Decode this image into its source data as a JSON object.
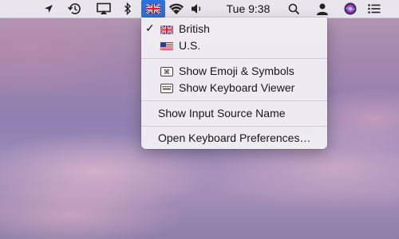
{
  "menubar": {
    "clock": "Tue 9:38",
    "icons": [
      "location-arrow-icon",
      "time-machine-icon",
      "airplay-icon",
      "bluetooth-icon",
      "input-source-flag-icon",
      "wifi-icon",
      "volume-icon",
      "spotlight-search-icon",
      "user-icon",
      "siri-icon",
      "notification-center-icon"
    ],
    "input_source_highlight_color": "#2f6fd8"
  },
  "menu": {
    "sources": [
      {
        "label": "British",
        "checked": true,
        "icon": "uk-flag-icon"
      },
      {
        "label": "U.S.",
        "checked": false,
        "icon": "us-flag-icon"
      }
    ],
    "tools": [
      {
        "label": "Show Emoji & Symbols",
        "icon": "emoji-symbols-icon"
      },
      {
        "label": "Show Keyboard Viewer",
        "icon": "keyboard-viewer-icon"
      }
    ],
    "show_input_source_name": "Show Input Source Name",
    "open_keyboard_preferences": "Open Keyboard Preferences…",
    "check_mark": "✓"
  }
}
